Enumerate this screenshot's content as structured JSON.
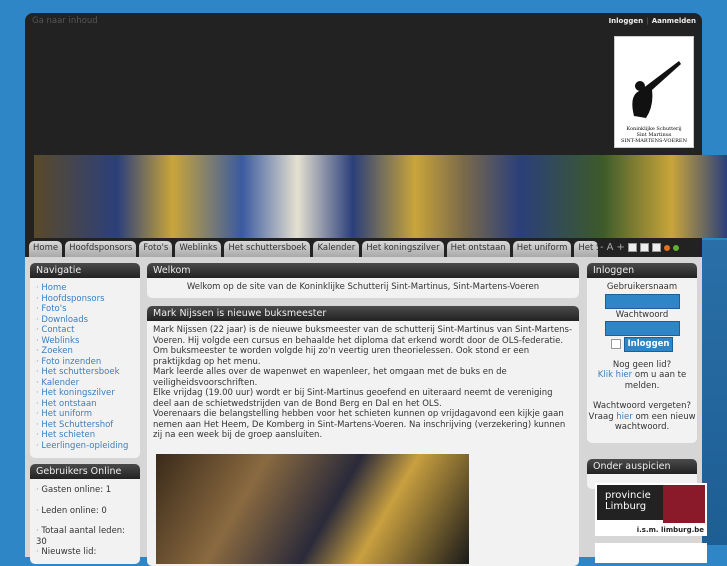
{
  "header": {
    "skip_link": "Ga naar inhoud",
    "login_link": "Inloggen",
    "register_link": "Aanmelden",
    "logo_text": [
      "Koninklijke Schutterij",
      "Sint Martinus",
      "SINT-MARTENS-VOEREN"
    ]
  },
  "tabs": [
    "Home",
    "Hoofdsponsors",
    "Foto's",
    "Weblinks",
    "Het schuttersboek",
    "Kalender",
    "Het koningszilver",
    "Het ontstaan",
    "Het uniform",
    "Het S"
  ],
  "font_tools": {
    "smaller": "-",
    "a": "A",
    "larger": "+"
  },
  "navigation": {
    "title": "Navigatie",
    "items": [
      "Home",
      "Hoofdsponsors",
      "Foto's",
      "Downloads",
      "Contact",
      "Weblinks",
      "Zoeken",
      "Foto inzenden",
      "Het schuttersboek",
      "Kalender",
      "Het koningszilver",
      "Het ontstaan",
      "Het uniform",
      "Het Schuttershof",
      "Het schieten",
      "Leerlingen-opleiding"
    ]
  },
  "online": {
    "title": "Gebruikers Online",
    "guests": "Gasten online: 1",
    "members": "Leden online: 0",
    "total": "Totaal aantal leden: 30",
    "newest": "Nieuwste lid:"
  },
  "welcome": {
    "title": "Welkom",
    "text": "Welkom op de site van de Koninklijke Schutterij Sint-Martinus, Sint-Martens-Voeren"
  },
  "article": {
    "title": "Mark Nijssen is nieuwe buksmeester",
    "paragraphs": [
      "Mark Nijssen (22 jaar) is de nieuwe buksmeester van de schutterij Sint-Martinus van Sint-Martens-Voeren. Hij volgde een cursus en behaalde het diploma dat erkend wordt door de OLS-federatie. Om buksmeester te worden volgde hij zo'n veertig uren theorielessen. Ook stond er een praktijkdag op het menu.",
      "Mark leerde alles over de wapenwet en wapenleer, het omgaan met de buks en de veiligheidsvoorschriften.",
      "Elke vrijdag (19.00 uur) wordt er bij Sint-Martinus geoefend en uiteraard neemt de vereniging deel aan de schietwedstrijden van de Bond Berg en Dal en het OLS.",
      "Voerenaars die belangstelling hebben voor het schieten kunnen op vrijdagavond een kijkje gaan nemen aan Het Heem, De Komberg in Sint-Martens-Voeren. Na inschrijving (verzekering) kunnen zij na een week bij de groep aansluiten."
    ]
  },
  "login": {
    "title": "Inloggen",
    "username_label": "Gebruikersnaam",
    "password_label": "Wachtwoord",
    "button": "Inloggen",
    "no_member": "Nog geen lid?",
    "click_here": "Klik hier",
    "register_rest": " om u aan te melden.",
    "forgot": "Wachtwoord vergeten?",
    "ask": "Vraag ",
    "here": "hier",
    "forgot_rest": " om een nieuw wachtwoord."
  },
  "sponsors": {
    "title": "Onder auspicien",
    "logo_line1": "provincie",
    "logo_line2": "Limburg",
    "logo_sub": "i.s.m. limburg.be"
  }
}
